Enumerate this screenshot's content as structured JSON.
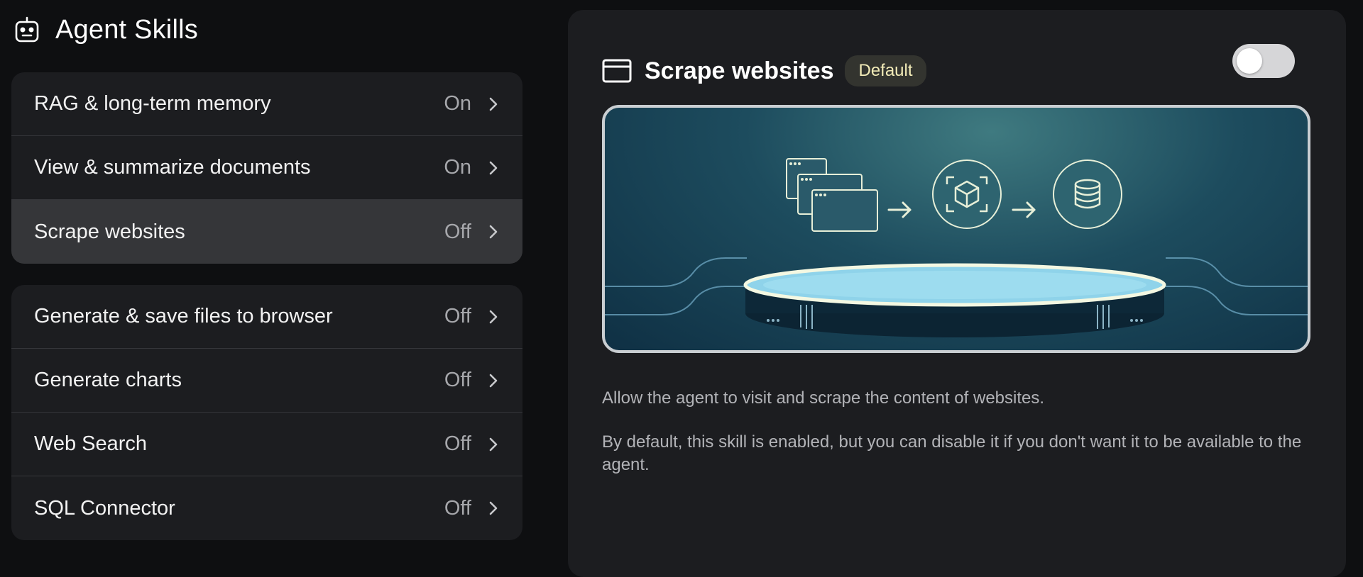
{
  "header": {
    "title": "Agent Skills",
    "icon": "robot-icon"
  },
  "skills_group_1": [
    {
      "label": "RAG & long-term memory",
      "status": "On"
    },
    {
      "label": "View & summarize documents",
      "status": "On"
    },
    {
      "label": "Scrape websites",
      "status": "Off",
      "selected": true
    }
  ],
  "skills_group_2": [
    {
      "label": "Generate & save files to browser",
      "status": "Off"
    },
    {
      "label": "Generate charts",
      "status": "Off"
    },
    {
      "label": "Web Search",
      "status": "Off"
    },
    {
      "label": "SQL Connector",
      "status": "Off"
    }
  ],
  "detail": {
    "title": "Scrape websites",
    "icon": "browser-window-icon",
    "badge": "Default",
    "toggle_on": false,
    "description_1": "Allow the agent to visit and scrape the content of websites.",
    "description_2": "By default, this skill is enabled, but you can disable it if you don't want it to be available to the agent."
  },
  "colors": {
    "background": "#0e0f11",
    "card": "#1c1d20",
    "selected_row": "#353639",
    "badge_text": "#f3ecb8"
  }
}
